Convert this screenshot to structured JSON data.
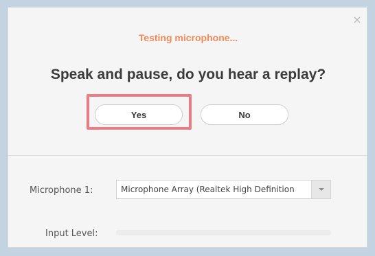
{
  "dialog": {
    "close_glyph": "×",
    "status": "Testing microphone...",
    "question": "Speak and pause, do you hear a replay?",
    "yes_label": "Yes",
    "no_label": "No"
  },
  "settings": {
    "microphone_label": "Microphone 1:",
    "microphone_value": "Microphone Array (Realtek High Definition",
    "input_level_label": "Input Level:"
  },
  "icons": {
    "close": "close-icon",
    "dropdown": "chevron-down-icon"
  },
  "colors": {
    "status_text": "#ef8a5a",
    "highlight": "#ea7c86",
    "background": "#c4d3e2"
  }
}
